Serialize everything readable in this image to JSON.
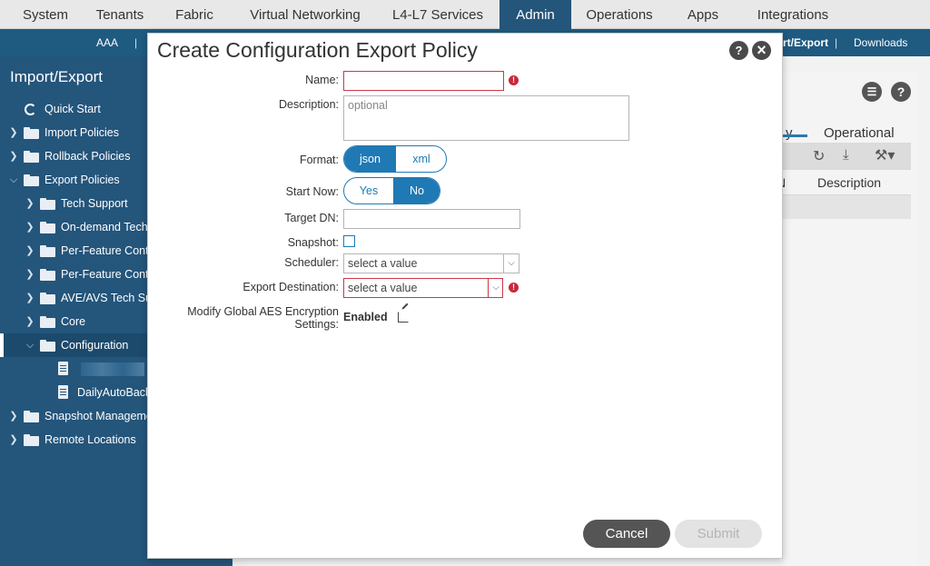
{
  "topnav": {
    "tabs": [
      "System",
      "Tenants",
      "Fabric",
      "Virtual Networking",
      "L4-L7 Services",
      "Admin",
      "Operations",
      "Apps",
      "Integrations"
    ],
    "active": "Admin"
  },
  "subnav": {
    "items": [
      "AAA",
      "rt/Export",
      "Downloads"
    ],
    "separator": "|"
  },
  "sidebar": {
    "title": "Import/Export",
    "items": [
      {
        "label": "Quick Start"
      },
      {
        "label": "Import Policies"
      },
      {
        "label": "Rollback Policies"
      },
      {
        "label": "Export Policies"
      },
      {
        "label": "Tech Support"
      },
      {
        "label": "On-demand Tech"
      },
      {
        "label": "Per-Feature Cont"
      },
      {
        "label": "Per-Feature Cont"
      },
      {
        "label": "AVE/AVS Tech Su"
      },
      {
        "label": "Core"
      },
      {
        "label": "Configuration"
      },
      {
        "label": ""
      },
      {
        "label": "DailyAutoBack"
      },
      {
        "label": "Snapshot Manageme"
      },
      {
        "label": "Remote Locations"
      }
    ]
  },
  "background": {
    "tab_partial": "y",
    "tab_operational": "Operational",
    "col_partial": "N",
    "col_description": "Description"
  },
  "modal": {
    "title": "Create Configuration Export Policy",
    "help_icon": "?",
    "close_icon": "×",
    "fields": {
      "name_label": "Name:",
      "name_value": "",
      "description_label": "Description:",
      "description_placeholder": "optional",
      "format_label": "Format:",
      "format_options": [
        "json",
        "xml"
      ],
      "format_selected": "json",
      "start_now_label": "Start Now:",
      "start_now_options": [
        "Yes",
        "No"
      ],
      "start_now_selected": "No",
      "target_dn_label": "Target DN:",
      "target_dn_value": "",
      "snapshot_label": "Snapshot:",
      "snapshot_checked": false,
      "scheduler_label": "Scheduler:",
      "scheduler_value": "select a value",
      "export_dest_label": "Export Destination:",
      "export_dest_value": "select a value",
      "aes_label_line1": "Modify Global AES Encryption",
      "aes_label_line2": "Settings:",
      "aes_value": "Enabled"
    },
    "required_mark": "!",
    "buttons": {
      "cancel": "Cancel",
      "submit": "Submit"
    }
  },
  "colors": {
    "accent": "#1f79b4",
    "sidebar_bg": "#24557b",
    "error": "#c8283a"
  }
}
